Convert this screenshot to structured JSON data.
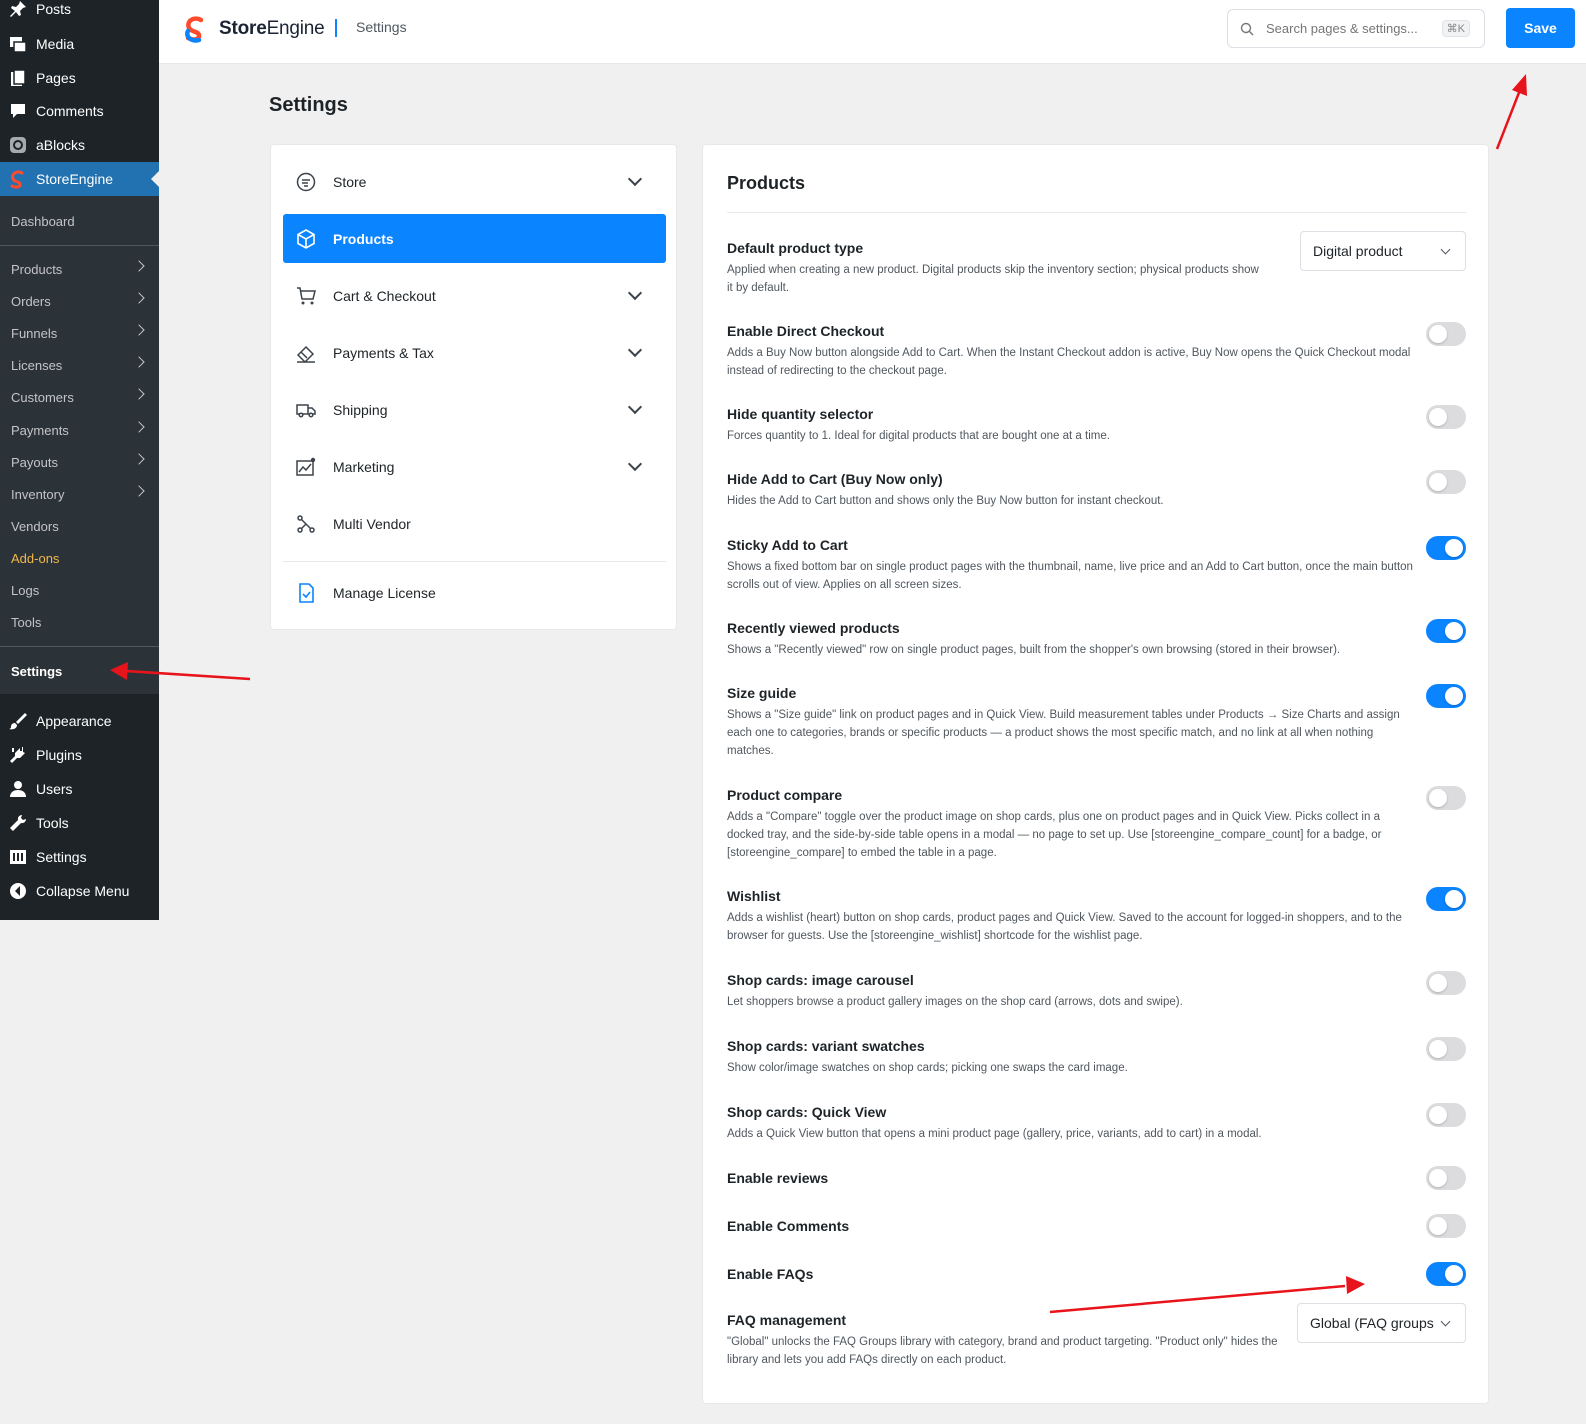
{
  "wp_menu": {
    "top": [
      {
        "label": "Posts",
        "icon": "pin-icon"
      },
      {
        "label": "Media",
        "icon": "media-icon"
      },
      {
        "label": "Pages",
        "icon": "pages-icon"
      },
      {
        "label": "Comments",
        "icon": "comment-icon"
      },
      {
        "label": "aBlocks",
        "icon": "ablocks-icon"
      },
      {
        "label": "StoreEngine",
        "icon": "storeengine-icon"
      }
    ],
    "storeengine_sub": [
      {
        "label": "Dashboard"
      },
      {
        "label": "Products"
      },
      {
        "label": "Orders"
      },
      {
        "label": "Funnels"
      },
      {
        "label": "Licenses"
      },
      {
        "label": "Customers"
      },
      {
        "label": "Payments"
      },
      {
        "label": "Payouts"
      },
      {
        "label": "Inventory"
      },
      {
        "label": "Vendors"
      },
      {
        "label": "Add-ons",
        "color": "#f0b849"
      },
      {
        "label": "Logs"
      },
      {
        "label": "Tools"
      },
      {
        "label": "Settings"
      }
    ],
    "bottom": [
      {
        "label": "Appearance",
        "icon": "brush-icon"
      },
      {
        "label": "Plugins",
        "icon": "plugin-icon"
      },
      {
        "label": "Users",
        "icon": "user-icon"
      },
      {
        "label": "Tools",
        "icon": "wrench-icon"
      },
      {
        "label": "Settings",
        "icon": "settings-icon"
      },
      {
        "label": "Collapse Menu",
        "icon": "collapse-icon"
      }
    ]
  },
  "header": {
    "brand_bold": "Store",
    "brand_light": "Engine",
    "breadcrumb": "Settings",
    "search_placeholder": "Search pages & settings...",
    "shortcut": "⌘K",
    "save_label": "Save"
  },
  "page_title": "Settings",
  "settings_nav": [
    {
      "label": "Store",
      "icon": "store-icon",
      "expandable": true
    },
    {
      "label": "Products",
      "icon": "box-icon",
      "selected": true
    },
    {
      "label": "Cart & Checkout",
      "icon": "cart-icon",
      "expandable": true
    },
    {
      "label": "Payments & Tax",
      "icon": "payments-icon",
      "expandable": true
    },
    {
      "label": "Shipping",
      "icon": "truck-icon",
      "expandable": true
    },
    {
      "label": "Marketing",
      "icon": "chart-icon",
      "expandable": true
    },
    {
      "label": "Multi Vendor",
      "icon": "vendor-icon"
    },
    {
      "label": "Manage License",
      "icon": "license-icon"
    }
  ],
  "products_panel": {
    "title": "Products",
    "default_type": {
      "title": "Default product type",
      "desc": "Applied when creating a new product. Digital products skip the inventory section; physical products show it by default.",
      "value": "Digital product"
    },
    "toggles": [
      {
        "title": "Enable Direct Checkout",
        "desc": "Adds a Buy Now button alongside Add to Cart. When the Instant Checkout addon is active, Buy Now opens the Quick Checkout modal instead of redirecting to the checkout page.",
        "on": false
      },
      {
        "title": "Hide quantity selector",
        "desc": "Forces quantity to 1. Ideal for digital products that are bought one at a time.",
        "on": false
      },
      {
        "title": "Hide Add to Cart (Buy Now only)",
        "desc": "Hides the Add to Cart button and shows only the Buy Now button for instant checkout.",
        "on": false
      },
      {
        "title": "Sticky Add to Cart",
        "desc": "Shows a fixed bottom bar on single product pages with the thumbnail, name, live price and an Add to Cart button, once the main button scrolls out of view. Applies on all screen sizes.",
        "on": true
      },
      {
        "title": "Recently viewed products",
        "desc": "Shows a \"Recently viewed\" row on single product pages, built from the shopper's own browsing (stored in their browser).",
        "on": true
      },
      {
        "title": "Size guide",
        "desc": "Shows a \"Size guide\" link on product pages and in Quick View. Build measurement tables under Products → Size Charts and assign each one to categories, brands or specific products — a product shows the most specific match, and no link at all when nothing matches.",
        "on": true
      },
      {
        "title": "Product compare",
        "desc": "Adds a \"Compare\" toggle over the product image on shop cards, plus one on product pages and in Quick View. Picks collect in a docked tray, and the side-by-side table opens in a modal — no page to set up. Use [storeengine_compare_count] for a badge, or [storeengine_compare] to embed the table in a page.",
        "on": false
      },
      {
        "title": "Wishlist",
        "desc": "Adds a wishlist (heart) button on shop cards, product pages and Quick View. Saved to the account for logged-in shoppers, and to the browser for guests. Use the [storeengine_wishlist] shortcode for the wishlist page.",
        "on": true
      },
      {
        "title": "Shop cards: image carousel",
        "desc": "Let shoppers browse a product gallery images on the shop card (arrows, dots and swipe).",
        "on": false
      },
      {
        "title": "Shop cards: variant swatches",
        "desc": "Show color/image swatches on shop cards; picking one swaps the card image.",
        "on": false
      },
      {
        "title": "Shop cards: Quick View",
        "desc": "Adds a Quick View button that opens a mini product page (gallery, price, variants, add to cart) in a modal.",
        "on": false
      },
      {
        "title": "Enable reviews",
        "desc": "",
        "on": false
      },
      {
        "title": "Enable Comments",
        "desc": "",
        "on": false
      },
      {
        "title": "Enable FAQs",
        "desc": "",
        "on": true
      }
    ],
    "faq_management": {
      "title": "FAQ management",
      "desc": "\"Global\" unlocks the FAQ Groups library with category, brand and product targeting. \"Product only\" hides the library and lets you add FAQs directly on each product.",
      "value": "Global (FAQ groups"
    }
  },
  "colors": {
    "accent": "#0a84ff",
    "wp_sidebar": "#1d2327",
    "annotation_arrow": "#e8141b"
  }
}
